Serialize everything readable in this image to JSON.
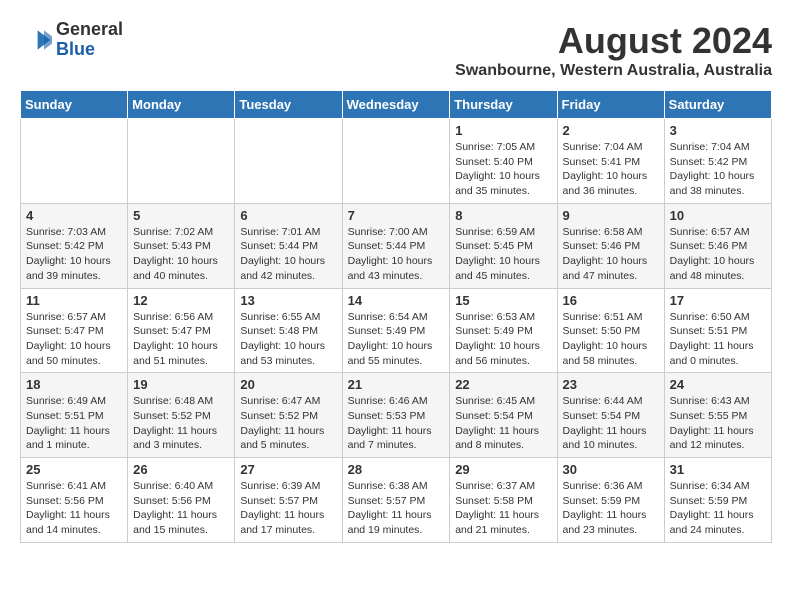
{
  "header": {
    "logo_line1": "General",
    "logo_line2": "Blue",
    "month_year": "August 2024",
    "location": "Swanbourne, Western Australia, Australia"
  },
  "weekdays": [
    "Sunday",
    "Monday",
    "Tuesday",
    "Wednesday",
    "Thursday",
    "Friday",
    "Saturday"
  ],
  "weeks": [
    [
      {
        "day": "",
        "info": ""
      },
      {
        "day": "",
        "info": ""
      },
      {
        "day": "",
        "info": ""
      },
      {
        "day": "",
        "info": ""
      },
      {
        "day": "1",
        "info": "Sunrise: 7:05 AM\nSunset: 5:40 PM\nDaylight: 10 hours\nand 35 minutes."
      },
      {
        "day": "2",
        "info": "Sunrise: 7:04 AM\nSunset: 5:41 PM\nDaylight: 10 hours\nand 36 minutes."
      },
      {
        "day": "3",
        "info": "Sunrise: 7:04 AM\nSunset: 5:42 PM\nDaylight: 10 hours\nand 38 minutes."
      }
    ],
    [
      {
        "day": "4",
        "info": "Sunrise: 7:03 AM\nSunset: 5:42 PM\nDaylight: 10 hours\nand 39 minutes."
      },
      {
        "day": "5",
        "info": "Sunrise: 7:02 AM\nSunset: 5:43 PM\nDaylight: 10 hours\nand 40 minutes."
      },
      {
        "day": "6",
        "info": "Sunrise: 7:01 AM\nSunset: 5:44 PM\nDaylight: 10 hours\nand 42 minutes."
      },
      {
        "day": "7",
        "info": "Sunrise: 7:00 AM\nSunset: 5:44 PM\nDaylight: 10 hours\nand 43 minutes."
      },
      {
        "day": "8",
        "info": "Sunrise: 6:59 AM\nSunset: 5:45 PM\nDaylight: 10 hours\nand 45 minutes."
      },
      {
        "day": "9",
        "info": "Sunrise: 6:58 AM\nSunset: 5:46 PM\nDaylight: 10 hours\nand 47 minutes."
      },
      {
        "day": "10",
        "info": "Sunrise: 6:57 AM\nSunset: 5:46 PM\nDaylight: 10 hours\nand 48 minutes."
      }
    ],
    [
      {
        "day": "11",
        "info": "Sunrise: 6:57 AM\nSunset: 5:47 PM\nDaylight: 10 hours\nand 50 minutes."
      },
      {
        "day": "12",
        "info": "Sunrise: 6:56 AM\nSunset: 5:47 PM\nDaylight: 10 hours\nand 51 minutes."
      },
      {
        "day": "13",
        "info": "Sunrise: 6:55 AM\nSunset: 5:48 PM\nDaylight: 10 hours\nand 53 minutes."
      },
      {
        "day": "14",
        "info": "Sunrise: 6:54 AM\nSunset: 5:49 PM\nDaylight: 10 hours\nand 55 minutes."
      },
      {
        "day": "15",
        "info": "Sunrise: 6:53 AM\nSunset: 5:49 PM\nDaylight: 10 hours\nand 56 minutes."
      },
      {
        "day": "16",
        "info": "Sunrise: 6:51 AM\nSunset: 5:50 PM\nDaylight: 10 hours\nand 58 minutes."
      },
      {
        "day": "17",
        "info": "Sunrise: 6:50 AM\nSunset: 5:51 PM\nDaylight: 11 hours\nand 0 minutes."
      }
    ],
    [
      {
        "day": "18",
        "info": "Sunrise: 6:49 AM\nSunset: 5:51 PM\nDaylight: 11 hours\nand 1 minute."
      },
      {
        "day": "19",
        "info": "Sunrise: 6:48 AM\nSunset: 5:52 PM\nDaylight: 11 hours\nand 3 minutes."
      },
      {
        "day": "20",
        "info": "Sunrise: 6:47 AM\nSunset: 5:52 PM\nDaylight: 11 hours\nand 5 minutes."
      },
      {
        "day": "21",
        "info": "Sunrise: 6:46 AM\nSunset: 5:53 PM\nDaylight: 11 hours\nand 7 minutes."
      },
      {
        "day": "22",
        "info": "Sunrise: 6:45 AM\nSunset: 5:54 PM\nDaylight: 11 hours\nand 8 minutes."
      },
      {
        "day": "23",
        "info": "Sunrise: 6:44 AM\nSunset: 5:54 PM\nDaylight: 11 hours\nand 10 minutes."
      },
      {
        "day": "24",
        "info": "Sunrise: 6:43 AM\nSunset: 5:55 PM\nDaylight: 11 hours\nand 12 minutes."
      }
    ],
    [
      {
        "day": "25",
        "info": "Sunrise: 6:41 AM\nSunset: 5:56 PM\nDaylight: 11 hours\nand 14 minutes."
      },
      {
        "day": "26",
        "info": "Sunrise: 6:40 AM\nSunset: 5:56 PM\nDaylight: 11 hours\nand 15 minutes."
      },
      {
        "day": "27",
        "info": "Sunrise: 6:39 AM\nSunset: 5:57 PM\nDaylight: 11 hours\nand 17 minutes."
      },
      {
        "day": "28",
        "info": "Sunrise: 6:38 AM\nSunset: 5:57 PM\nDaylight: 11 hours\nand 19 minutes."
      },
      {
        "day": "29",
        "info": "Sunrise: 6:37 AM\nSunset: 5:58 PM\nDaylight: 11 hours\nand 21 minutes."
      },
      {
        "day": "30",
        "info": "Sunrise: 6:36 AM\nSunset: 5:59 PM\nDaylight: 11 hours\nand 23 minutes."
      },
      {
        "day": "31",
        "info": "Sunrise: 6:34 AM\nSunset: 5:59 PM\nDaylight: 11 hours\nand 24 minutes."
      }
    ]
  ]
}
